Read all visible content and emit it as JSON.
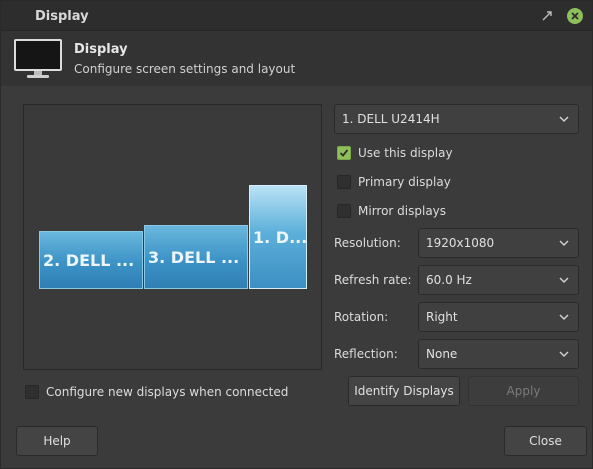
{
  "window": {
    "title": "Display"
  },
  "header": {
    "title": "Display",
    "subtitle": "Configure screen settings and layout"
  },
  "preview": {
    "monitors": [
      {
        "label": "2. DELL ...",
        "active": false
      },
      {
        "label": "3. DELL ...",
        "active": false
      },
      {
        "label": "1. D...",
        "active": true
      }
    ]
  },
  "output_select": {
    "value": "1. DELL U2414H"
  },
  "checks": {
    "use_display": {
      "label": "Use this display",
      "checked": true
    },
    "primary": {
      "label": "Primary display",
      "checked": false
    },
    "mirror": {
      "label": "Mirror displays",
      "checked": false
    },
    "auto_configure": {
      "label": "Configure new displays when connected",
      "checked": false
    }
  },
  "props": {
    "resolution": {
      "label": "Resolution:",
      "value": "1920x1080"
    },
    "refresh": {
      "label": "Refresh rate:",
      "value": "60.0 Hz"
    },
    "rotation": {
      "label": "Rotation:",
      "value": "Right"
    },
    "reflection": {
      "label": "Reflection:",
      "value": "None"
    }
  },
  "buttons": {
    "identify": "Identify Displays",
    "apply": "Apply",
    "help": "Help",
    "close": "Close"
  },
  "colors": {
    "accent": "#8fbf5b",
    "monitor_fill": "#3c93c6",
    "window_bg": "#3b3b3b"
  }
}
